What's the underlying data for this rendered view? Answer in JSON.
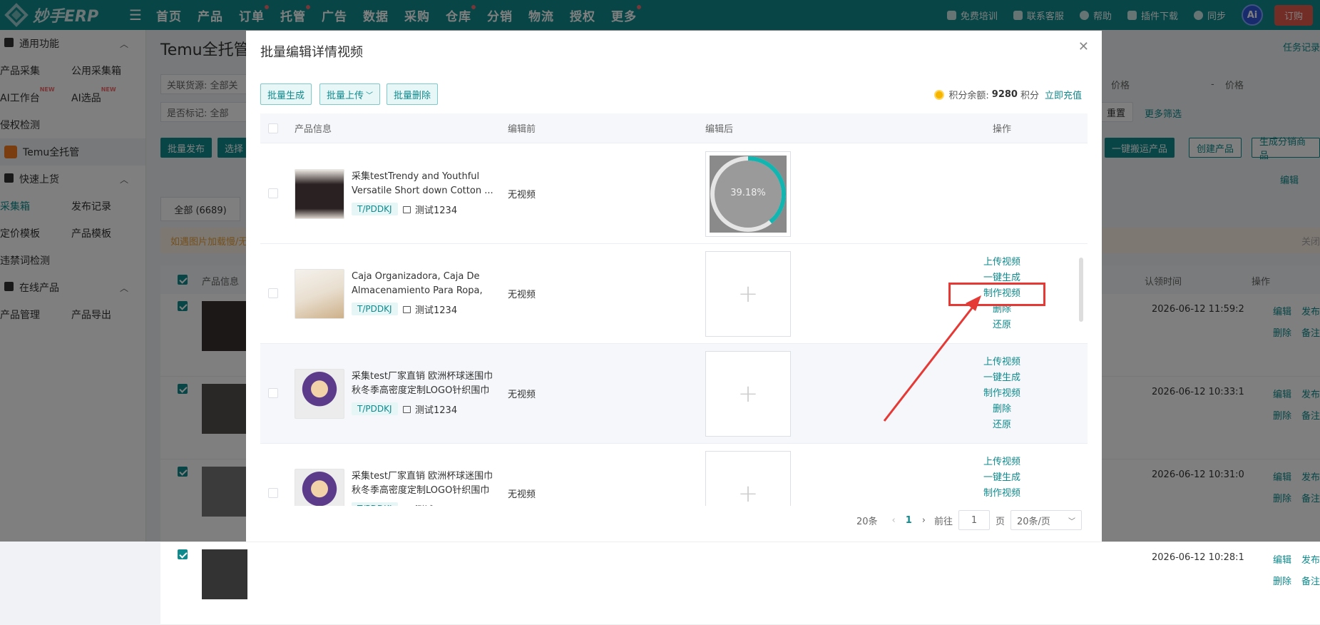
{
  "app": {
    "logo_text": "妙手ERP"
  },
  "nav": {
    "items": [
      {
        "label": "首页",
        "dot": false
      },
      {
        "label": "产品",
        "dot": false
      },
      {
        "label": "订单",
        "dot": true
      },
      {
        "label": "托管",
        "dot": true
      },
      {
        "label": "广告",
        "dot": false
      },
      {
        "label": "数据",
        "dot": false
      },
      {
        "label": "采购",
        "dot": false
      },
      {
        "label": "仓库",
        "dot": true
      },
      {
        "label": "分销",
        "dot": false
      },
      {
        "label": "物流",
        "dot": false
      },
      {
        "label": "授权",
        "dot": false
      },
      {
        "label": "更多",
        "dot": true
      }
    ]
  },
  "topright": {
    "training": "免费培训",
    "support": "联系客服",
    "help": "帮助",
    "plugin": "插件下载",
    "sync": "同步",
    "ai": "Ai",
    "order": "订购"
  },
  "sidebar": {
    "group1": "通用功能",
    "item_collect": "产品采集",
    "item_public": "公用采集箱",
    "item_ai_desk": "AI工作台",
    "item_ai_select": "AI选品",
    "new_badge": "NEW",
    "item_infringe": "侵权检测",
    "item_temu": "Temu全托管",
    "group2": "快速上货",
    "item_box": "采集箱",
    "item_publish": "发布记录",
    "item_price_tpl": "定价模板",
    "item_prod_tpl": "产品模板",
    "item_banned": "违禁词检测",
    "group3": "在线产品",
    "item_manage": "产品管理",
    "item_export": "产品导出"
  },
  "main": {
    "title": "Temu全托管",
    "filter1": "关联货源:  全部关",
    "filter2": "是否标记:  全部",
    "price_a": "价格",
    "price_sep": "-",
    "price_b": "价格",
    "reset": "重置",
    "more_filter": "更多筛选",
    "task_log": "任务记录",
    "btn_publish": "批量发布",
    "btn_select": "选择",
    "btn_move": "一键搬运产品",
    "btn_create": "创建产品",
    "btn_dist": "生成分销商品",
    "edit_link": "编辑",
    "tab_all": "全部 (6689)",
    "notice": "如遇图片加载慢/无",
    "notice_close": "关闭",
    "col_info": "产品信息",
    "col_claim": "认领时间",
    "col_ops": "操作",
    "rows": [
      {
        "time": "2026-06-12 11:59:2",
        "op1": "编辑",
        "op2": "发布",
        "op3": "删除",
        "op4": "备注"
      },
      {
        "time": "2026-06-12 10:33:1",
        "op1": "编辑",
        "op2": "发布",
        "op3": "删除",
        "op4": "备注"
      },
      {
        "time": "2026-06-12 10:31:0",
        "op1": "编辑",
        "op2": "发布",
        "op3": "删除",
        "op4": "备注"
      },
      {
        "time": "2026-06-12 10:28:1",
        "op1": "编辑",
        "op2": "发布",
        "op3": "删除",
        "op4": "备注"
      }
    ]
  },
  "modal": {
    "title": "批量编辑详情视频",
    "btn_generate": "批量生成",
    "btn_upload": "批量上传",
    "btn_delete": "批量删除",
    "credits_label": "积分余额:",
    "credits_value": "9280",
    "credits_unit": "积分",
    "recharge": "立即充值",
    "col_info": "产品信息",
    "col_before": "编辑前",
    "col_after": "编辑后",
    "col_ops": "操作",
    "rows": [
      {
        "name": "采集testTrendy and Youthful Versatile Short down Cotton ...",
        "tag": "T/PDDKJ",
        "store": "测试1234",
        "before": "无视频",
        "progress": "39.18%",
        "ops": []
      },
      {
        "name": "Caja Organizadora, Caja De Almacenamiento Para Ropa, ...",
        "tag": "T/PDDKJ",
        "store": "测试1234",
        "before": "无视频",
        "progress": "",
        "ops": [
          "上传视频",
          "一键生成",
          "制作视频",
          "删除",
          "还原"
        ]
      },
      {
        "name": "采集test厂家直销 欧洲杯球迷围巾秋冬季高密度定制LOGO针织围巾",
        "tag": "T/PDDKJ",
        "store": "测试1234",
        "before": "无视频",
        "progress": "",
        "ops": [
          "上传视频",
          "一键生成",
          "制作视频",
          "删除",
          "还原"
        ]
      },
      {
        "name": "采集test厂家直销 欧洲杯球迷围巾秋冬季高密度定制LOGO针织围巾",
        "tag": "T/PDDKJ",
        "store": "测试1234",
        "before": "无视频",
        "progress": "",
        "ops": [
          "上传视频",
          "一键生成",
          "制作视频"
        ]
      }
    ],
    "pager": {
      "total": "20条",
      "page": "1",
      "goto": "前往",
      "page_input": "1",
      "page_unit": "页",
      "size": "20条/页"
    }
  },
  "colors": {
    "brand": "#0f8a8d",
    "highlight": "#e53935"
  }
}
